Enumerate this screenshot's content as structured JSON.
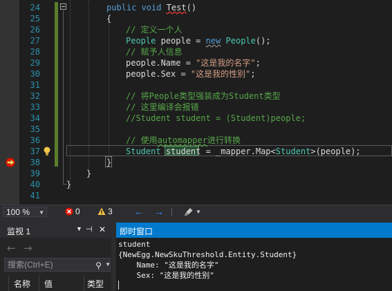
{
  "editor": {
    "line_numbers": [
      "24",
      "25",
      "26",
      "27",
      "28",
      "29",
      "30",
      "31",
      "32",
      "33",
      "34",
      "35",
      "36",
      "37",
      "38",
      "39",
      "40",
      "41"
    ],
    "code": {
      "l24_kw": "public void ",
      "l24_name": "Test",
      "l24_tail": "()",
      "l25": "{",
      "l26_cm": "// 定义一个人",
      "l27_type": "People",
      "l27_mid": " people = ",
      "l27_new": "new",
      "l27_sp": " ",
      "l27_type2": "People",
      "l27_tail": "();",
      "l28_cm": "// 赋予人信息",
      "l29_pre": "people.Name = ",
      "l29_str": "\"这是我的名字\"",
      "l29_tail": ";",
      "l30_pre": "people.Sex = ",
      "l30_str": "\"这是我的性别\"",
      "l30_tail": ";",
      "l32_cm": "// 将People类型强装成为Student类型",
      "l33_cm": "// 这里编译会报错",
      "l34_cm": "//Student student = (Student)people;",
      "l36_cm_a": "// 使用",
      "l36_cm_b": "automapper",
      "l36_cm_c": "进行转换",
      "l37_type": "Student",
      "l37_sp": " ",
      "l37_var": "student",
      "l37_mid": " = _mapper.Map<",
      "l37_type2": "Student",
      "l37_tail": ">(people);",
      "l38": "}",
      "l39": "}",
      "l40": "}"
    }
  },
  "status_strip": {
    "zoom": "100 %",
    "error_count": "0",
    "warning_count": "3"
  },
  "watch_panel": {
    "title": "监视 1",
    "search_placeholder": "搜索(Ctrl+E)",
    "columns": [
      "名称",
      "值",
      "类型"
    ]
  },
  "immediate_window": {
    "title": "即时窗口",
    "output": [
      "student",
      "{NewEgg.NewSkuThreshold.Entity.Student}",
      "    Name: \"这是我的名字\"",
      "    Sex: \"这是我的性别\""
    ]
  },
  "colors": {
    "accent": "#007acc",
    "keyword": "#569cd6",
    "type": "#4ec9b0",
    "string": "#d69d85",
    "comment": "#57a64a",
    "line_number": "#2b91af"
  }
}
